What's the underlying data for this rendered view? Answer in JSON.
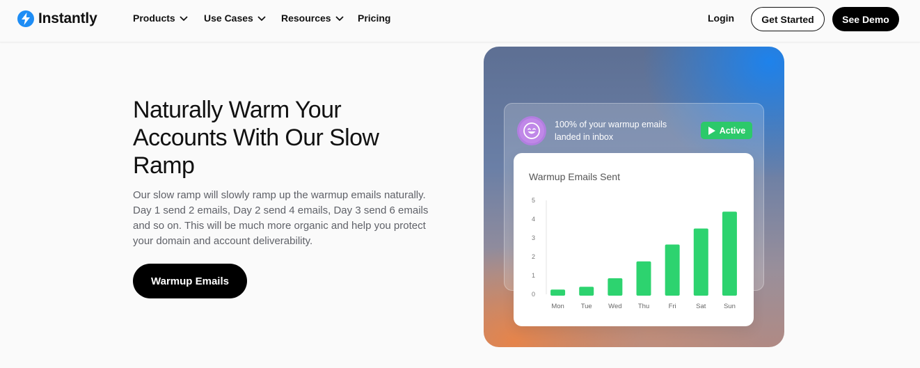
{
  "nav": {
    "brand": "Instantly",
    "menu": [
      {
        "label": "Products",
        "has_dropdown": true
      },
      {
        "label": "Use Cases",
        "has_dropdown": true
      },
      {
        "label": "Resources",
        "has_dropdown": true
      },
      {
        "label": "Pricing",
        "has_dropdown": false
      }
    ],
    "login": "Login",
    "get_started": "Get Started",
    "see_demo": "See Demo"
  },
  "hero": {
    "headline": "Naturally Warm Your Accounts With Our Slow Ramp",
    "description": "Our slow ramp will slowly ramp up the warmup emails naturally. Day 1 send 2 emails, Day 2 send 4 emails, Day 3 send 6 emails and so on. This will be much more organic and help you protect your domain and account deliverability.",
    "cta": "Warmup Emails"
  },
  "status": {
    "message": "100% of your warmup emails landed in inbox",
    "badge": "Active",
    "avatar_icon": "smiley-face-icon"
  },
  "colors": {
    "brand_blue": "#1e8df5",
    "bar_green": "#2dd36f",
    "badge_green": "#2cc96a",
    "avatar_purple": "#c088e8"
  },
  "chart_data": {
    "type": "bar",
    "title": "Warmup Emails Sent",
    "categories": [
      "Mon",
      "Tue",
      "Wed",
      "Thu",
      "Fri",
      "Sat",
      "Sun"
    ],
    "values": [
      0.25,
      0.4,
      0.85,
      1.75,
      2.65,
      3.5,
      4.4
    ],
    "y_ticks": [
      "0",
      "1",
      "2",
      "3",
      "4",
      "5"
    ],
    "ylim": [
      0,
      5
    ],
    "grid": false,
    "legend": "none"
  }
}
